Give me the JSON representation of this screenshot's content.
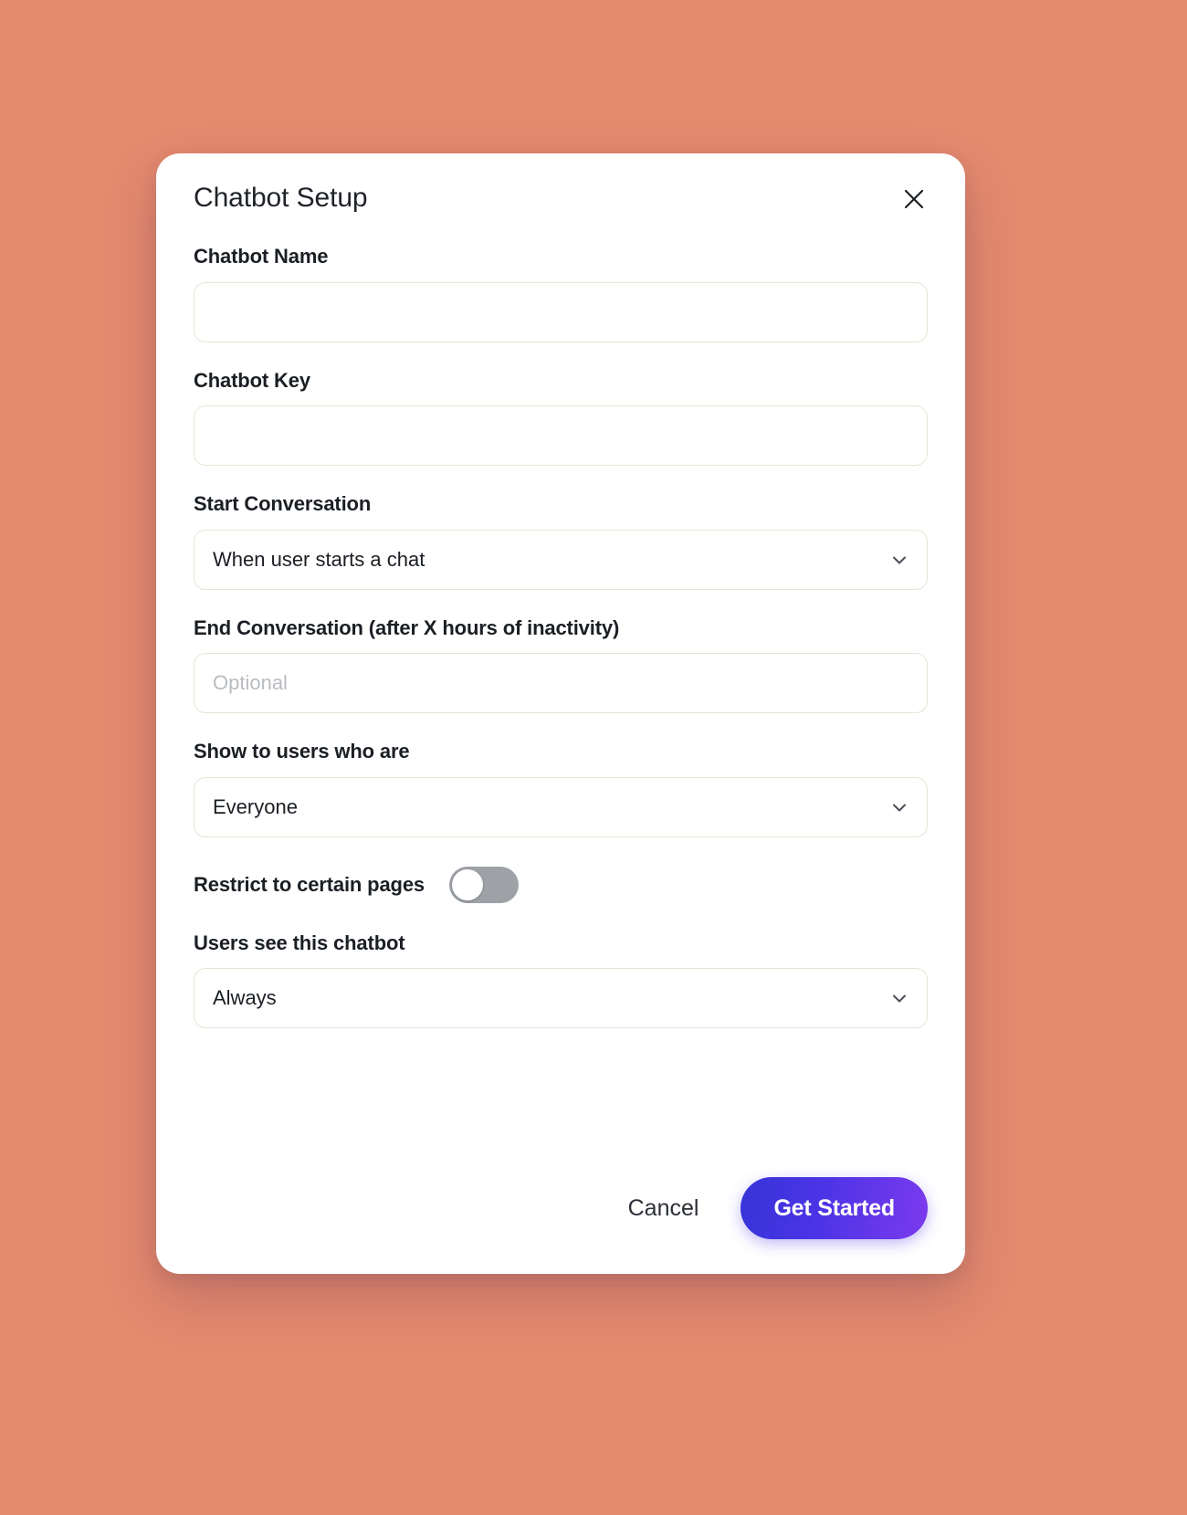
{
  "background": {
    "type": "mesh-gradient",
    "colors": [
      "#fb7268",
      "#f9b27c",
      "#45c5e8",
      "#cc52b8",
      "#7b3df0",
      "#f08a63"
    ]
  },
  "modal": {
    "title": "Chatbot Setup",
    "close_icon": "close-icon",
    "fields": {
      "chatbot_name": {
        "label": "Chatbot Name",
        "value": "",
        "placeholder": ""
      },
      "chatbot_key": {
        "label": "Chatbot Key",
        "value": "",
        "placeholder": ""
      },
      "start_conversation": {
        "label": "Start Conversation",
        "value": "When user starts a chat",
        "icon": "chevron-down-icon"
      },
      "end_conversation": {
        "label": "End Conversation (after X hours of inactivity)",
        "value": "",
        "placeholder": "Optional"
      },
      "show_to_users": {
        "label": "Show to users who are",
        "value": "Everyone",
        "icon": "chevron-down-icon"
      },
      "restrict_pages": {
        "label": "Restrict to certain pages",
        "enabled": false
      },
      "visibility": {
        "label": "Users see this chatbot",
        "value": "Always",
        "icon": "chevron-down-icon"
      }
    },
    "footer": {
      "cancel_label": "Cancel",
      "submit_label": "Get Started",
      "submit_gradient_start": "#3634d8",
      "submit_gradient_end": "#7c3aed"
    }
  }
}
